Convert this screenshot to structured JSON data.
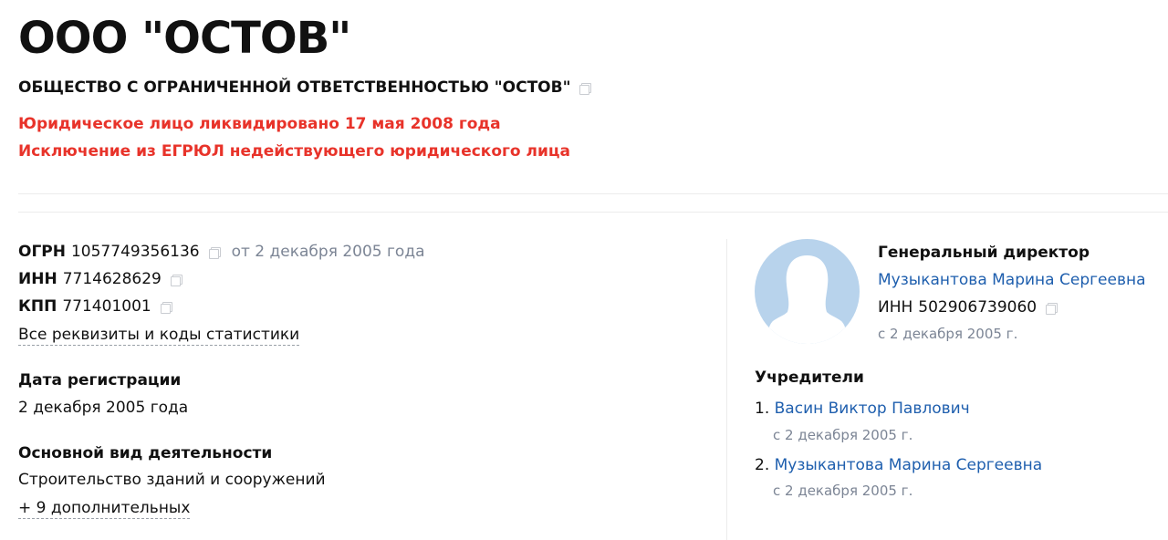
{
  "company": {
    "title": "ООО \"ОСТОВ\"",
    "full_name": "ОБЩЕСТВО С ОГРАНИЧЕННОЙ ОТВЕТСТВЕННОСТЬЮ \"ОСТОВ\"",
    "status_liquidated": "Юридическое лицо ликвидировано 17 мая 2008 года",
    "status_reason": "Исключение из ЕГРЮЛ недействующего юридического лица"
  },
  "requisites": {
    "ogrn_label": "ОГРН",
    "ogrn_value": "1057749356136",
    "ogrn_date": "от 2 декабря 2005 года",
    "inn_label": "ИНН",
    "inn_value": "7714628629",
    "kpp_label": "КПП",
    "kpp_value": "771401001",
    "all_link": "Все реквизиты и коды статистики"
  },
  "registration": {
    "label": "Дата регистрации",
    "value": "2 декабря 2005 года"
  },
  "activity": {
    "label": "Основной вид деятельности",
    "value": "Строительство зданий и сооружений",
    "more_link": "+ 9 дополнительных"
  },
  "director": {
    "role": "Генеральный директор",
    "name": "Музыкантова Марина Сергеевна",
    "inn_label": "ИНН",
    "inn_value": "502906739060",
    "since": "с 2 декабря 2005 г."
  },
  "founders": {
    "label": "Учредители",
    "items": [
      {
        "num": "1.",
        "name": "Васин Виктор Павлович",
        "since": "с 2 декабря 2005 г."
      },
      {
        "num": "2.",
        "name": "Музыкантова Марина Сергеевна",
        "since": "с 2 декабря 2005 г."
      }
    ]
  },
  "colors": {
    "status_red": "#e8332a",
    "link_blue": "#1f5fae",
    "muted_gray": "#7c8595",
    "avatar_bg": "#b8d3ec"
  },
  "icons": [
    "copy-icon",
    "avatar-silhouette-icon"
  ]
}
